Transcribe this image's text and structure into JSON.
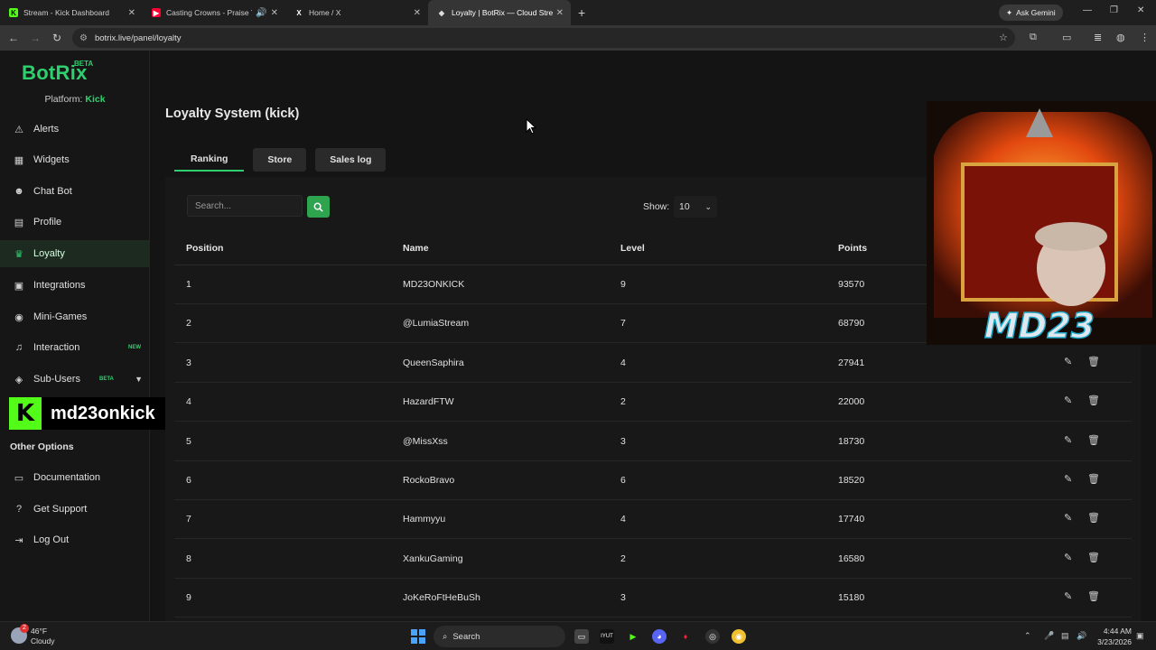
{
  "browser": {
    "tabs": [
      {
        "title": "Stream - Kick Dashboard",
        "favicon": "kick-favicon",
        "favicon_color": "#53fc18",
        "active": false
      },
      {
        "title": "Casting Crowns - Praise Yo...",
        "favicon": "youtube-favicon",
        "favicon_color": "#ff0033",
        "active": false
      },
      {
        "title": "Home / X",
        "favicon": "x-favicon",
        "favicon_color": "#ffffff",
        "active": false
      },
      {
        "title": "Loyalty | BotRix — Cloud Strea...",
        "favicon": "botrix-favicon",
        "favicon_color": "#cfcfcf",
        "active": true
      }
    ],
    "ask_gemini": "Ask Gemini",
    "url": "botrix.live/panel/loyalty"
  },
  "sidebar": {
    "logo": "BotRix",
    "logo_badge": "BETA",
    "platform_label": "Platform:",
    "platform_value": "Kick",
    "items": [
      {
        "label": "Alerts",
        "icon": "warning-icon",
        "glyph": "⚠"
      },
      {
        "label": "Widgets",
        "icon": "grid-icon",
        "glyph": "▦"
      },
      {
        "label": "Chat Bot",
        "icon": "robot-icon",
        "glyph": "☻"
      },
      {
        "label": "Profile",
        "icon": "id-card-icon",
        "glyph": "▤"
      },
      {
        "label": "Loyalty",
        "icon": "trophy-icon",
        "glyph": "♛",
        "active": true
      },
      {
        "label": "Integrations",
        "icon": "list-icon",
        "glyph": "▣"
      },
      {
        "label": "Mini-Games",
        "icon": "gamepad-icon",
        "glyph": "◉"
      },
      {
        "label": "Interaction",
        "icon": "music-icon",
        "glyph": "♫",
        "badge": "NEW"
      },
      {
        "label": "Sub-Users",
        "icon": "users-icon",
        "glyph": "◈",
        "badge": "BETA"
      }
    ],
    "other_options": "Other Options",
    "other_items": [
      {
        "label": "Documentation",
        "icon": "book-icon",
        "glyph": "▭"
      },
      {
        "label": "Get Support",
        "icon": "help-icon",
        "glyph": "?"
      },
      {
        "label": "Log Out",
        "icon": "logout-icon",
        "glyph": "⇥"
      }
    ]
  },
  "overlay": {
    "kick_letter": "K",
    "channel": "md23onkick"
  },
  "main": {
    "title": "Loyalty System (kick)",
    "tabs": [
      "Ranking",
      "Store",
      "Sales log"
    ],
    "search_placeholder": "Search...",
    "show_label": "Show:",
    "show_value": "10",
    "columns": [
      "Position",
      "Name",
      "Level",
      "Points"
    ],
    "rows": [
      {
        "position": "1",
        "name": "MD23ONKICK",
        "level": "9",
        "points": "93570"
      },
      {
        "position": "2",
        "name": "@LumiaStream",
        "level": "7",
        "points": "68790"
      },
      {
        "position": "3",
        "name": "QueenSaphira",
        "level": "4",
        "points": "27941"
      },
      {
        "position": "4",
        "name": "HazardFTW",
        "level": "2",
        "points": "22000"
      },
      {
        "position": "5",
        "name": "@MissXss",
        "level": "3",
        "points": "18730"
      },
      {
        "position": "6",
        "name": "RockoBravo",
        "level": "6",
        "points": "18520"
      },
      {
        "position": "7",
        "name": "Hammyyu",
        "level": "4",
        "points": "17740"
      },
      {
        "position": "8",
        "name": "XankuGaming",
        "level": "2",
        "points": "16580"
      },
      {
        "position": "9",
        "name": "JoKeRoFtHeBuSh",
        "level": "3",
        "points": "15180"
      }
    ]
  },
  "streamer_overlay": {
    "logo_text": "MD23"
  },
  "taskbar": {
    "temp": "46°F",
    "condition": "Cloudy",
    "weather_alert": "2",
    "search": "Search",
    "time": "4:44 AM",
    "date": "3/23/2026"
  },
  "colors": {
    "accent": "#2ed06e",
    "kick": "#53fc18",
    "bg": "#141414"
  }
}
